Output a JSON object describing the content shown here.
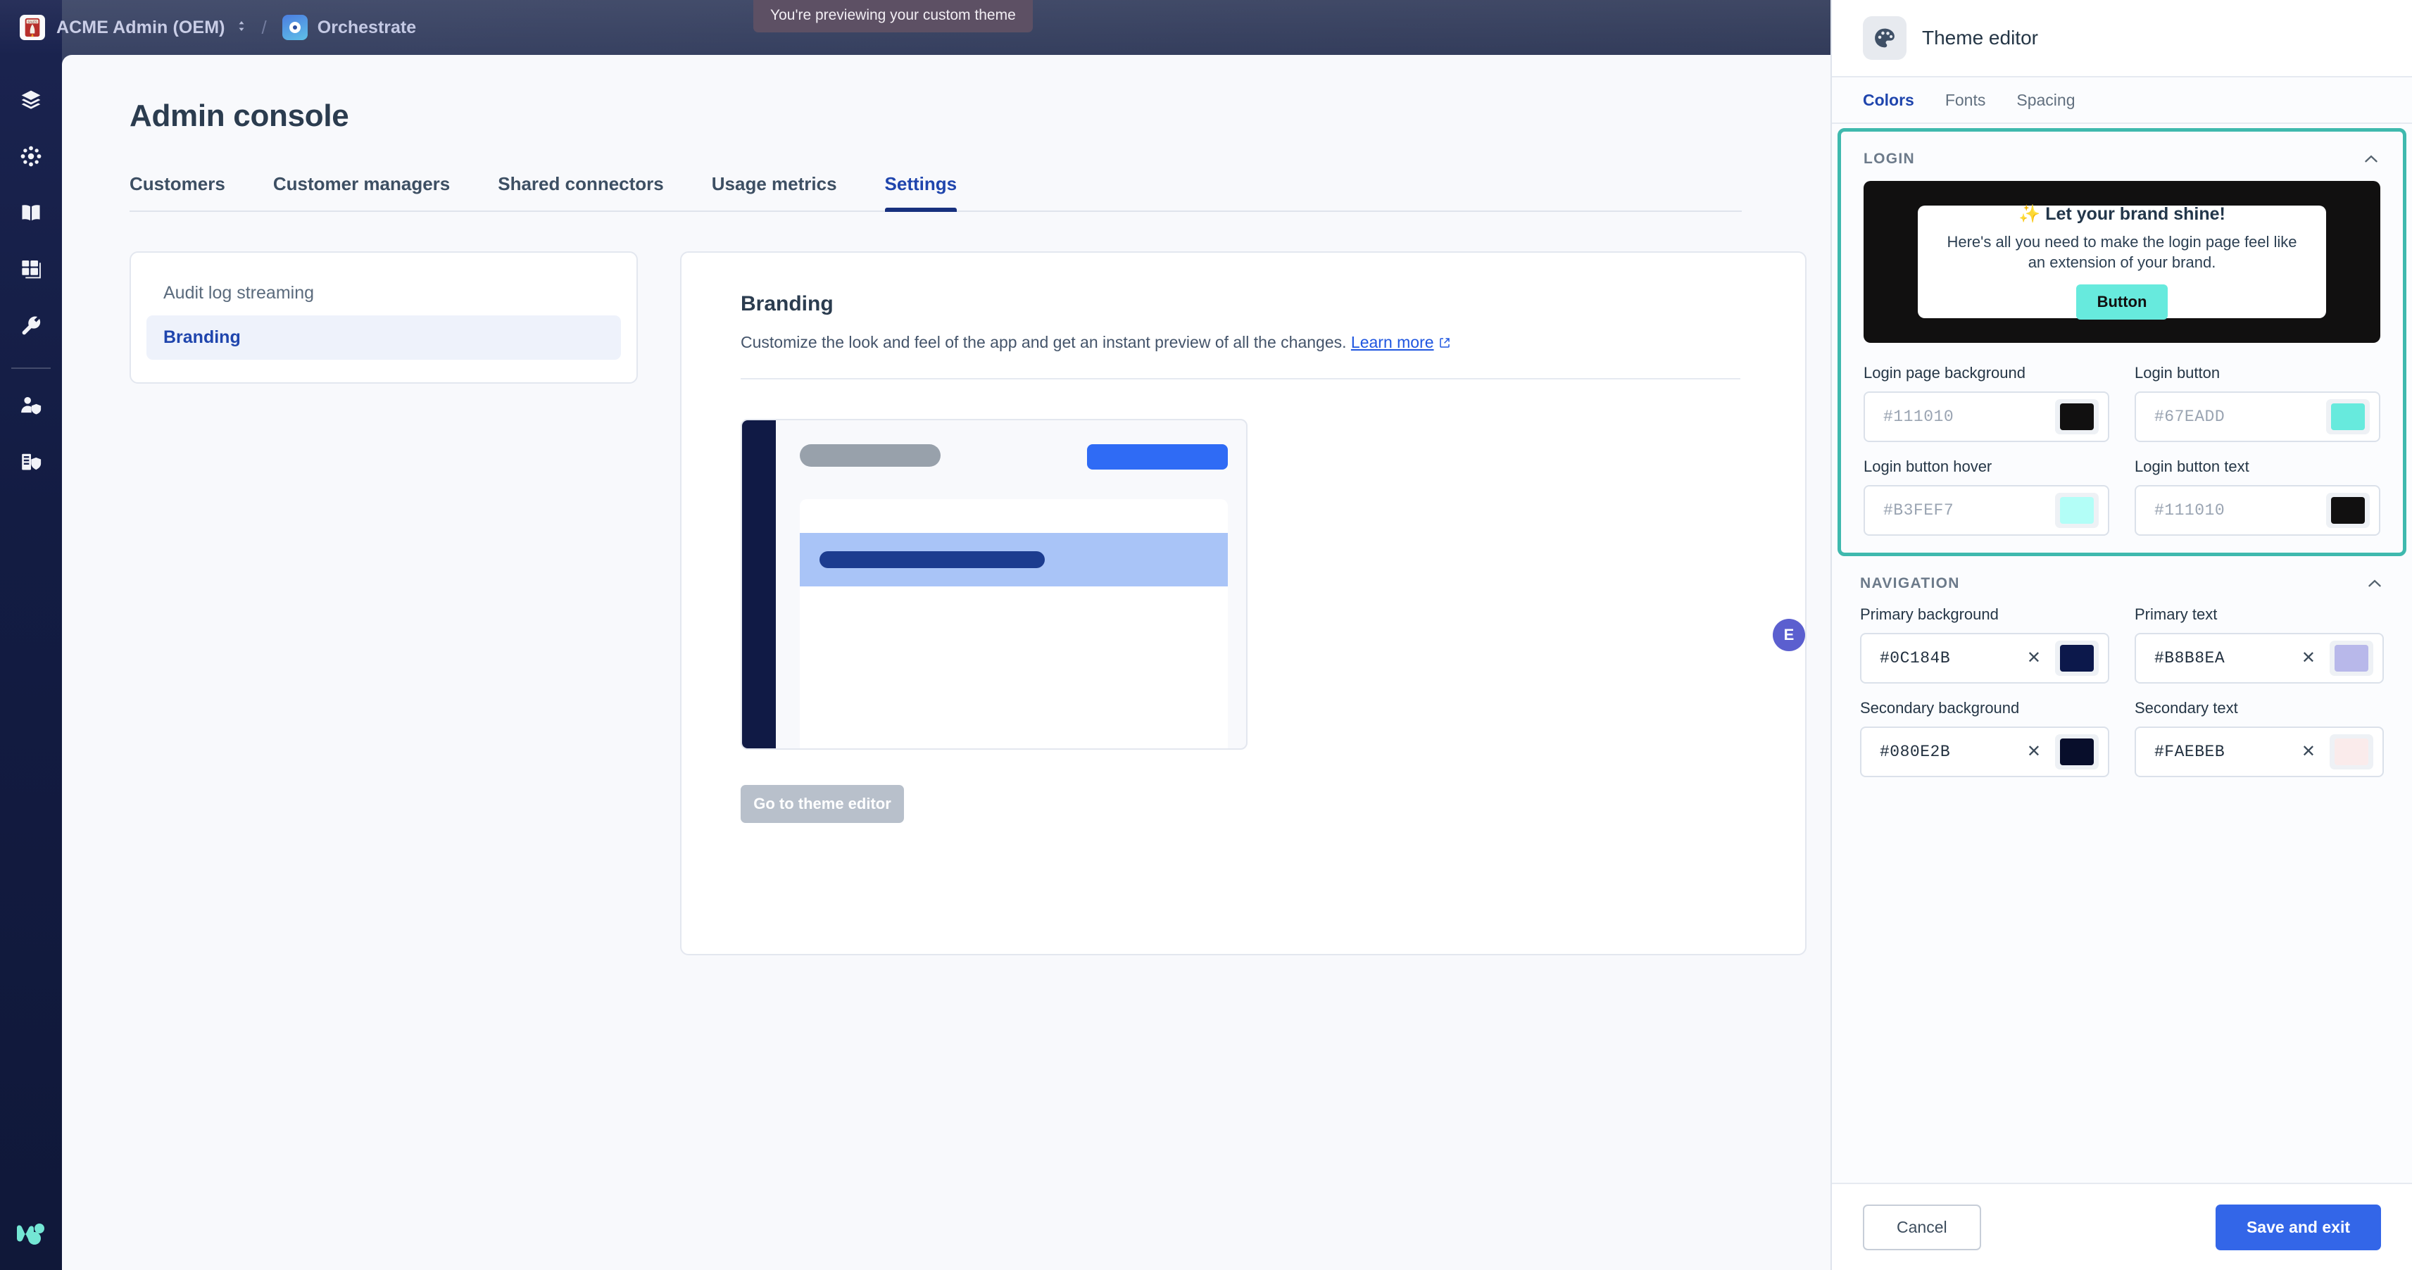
{
  "topbar": {
    "org_name": "ACME Admin (OEM)",
    "app_name": "Orchestrate",
    "preview_banner": "You're previewing your custom theme",
    "avatar_initial": "E"
  },
  "rail": {
    "items": [
      {
        "icon": "layers-icon"
      },
      {
        "icon": "connector-hub-icon"
      },
      {
        "icon": "book-icon"
      },
      {
        "icon": "dashboard-icon"
      },
      {
        "icon": "wrench-icon"
      },
      {
        "icon": "user-admin-icon"
      },
      {
        "icon": "org-admin-icon"
      }
    ],
    "logo": "workato-logo"
  },
  "page": {
    "title": "Admin console",
    "tabs": [
      {
        "label": "Customers",
        "active": false
      },
      {
        "label": "Customer managers",
        "active": false
      },
      {
        "label": "Shared connectors",
        "active": false
      },
      {
        "label": "Usage metrics",
        "active": false
      },
      {
        "label": "Settings",
        "active": true
      }
    ],
    "subnav": [
      {
        "label": "Audit log streaming",
        "active": false
      },
      {
        "label": "Branding",
        "active": true
      }
    ],
    "branding": {
      "title": "Branding",
      "description": "Customize the look and feel of the app and get an instant preview of all the changes.",
      "learn_more": "Learn more",
      "theme_editor_button": "Go to theme editor"
    }
  },
  "editor": {
    "title": "Theme editor",
    "icon": "palette-icon",
    "tabs": [
      {
        "label": "Colors",
        "active": true
      },
      {
        "label": "Fonts",
        "active": false
      },
      {
        "label": "Spacing",
        "active": false
      }
    ],
    "login_section": {
      "title": "LOGIN",
      "collapse_icon": "chevron-up-icon",
      "preview": {
        "heading": "✨ Let your brand shine!",
        "body": "Here's all you need to make the login page feel like an extension of your brand.",
        "button_label": "Button",
        "background": "#111010",
        "button_color": "#67EADD",
        "button_text_color": "#111010"
      },
      "fields": [
        {
          "label": "Login page background",
          "value": "#111010",
          "swatch": "#111010",
          "filled": false,
          "clearable": false
        },
        {
          "label": "Login button",
          "value": "#67EADD",
          "swatch": "#67EADD",
          "filled": false,
          "clearable": false
        },
        {
          "label": "Login button hover",
          "value": "#B3FEF7",
          "swatch": "#B3FEF7",
          "filled": false,
          "clearable": false
        },
        {
          "label": "Login button text",
          "value": "#111010",
          "swatch": "#111010",
          "filled": false,
          "clearable": false
        }
      ]
    },
    "navigation_section": {
      "title": "NAVIGATION",
      "collapse_icon": "chevron-up-icon",
      "fields": [
        {
          "label": "Primary background",
          "value": "#0C184B",
          "swatch": "#0C184B",
          "filled": true,
          "clearable": true
        },
        {
          "label": "Primary text",
          "value": "#B8B8EA",
          "swatch": "#B8B8EA",
          "filled": true,
          "clearable": true
        },
        {
          "label": "Secondary background",
          "value": "#080E2B",
          "swatch": "#080E2B",
          "filled": true,
          "clearable": true
        },
        {
          "label": "Secondary text",
          "value": "#FAEBEB",
          "swatch": "#FAEBEB",
          "filled": true,
          "clearable": true
        }
      ]
    },
    "footer": {
      "cancel_label": "Cancel",
      "save_label": "Save and exit"
    }
  },
  "mock_preview": {
    "rail_color": "#101a45",
    "button_color": "#2f6bf5",
    "pill_color": "#98a1ab",
    "row_color": "#a9c4f7",
    "row_bar_color": "#1c3c8f"
  }
}
